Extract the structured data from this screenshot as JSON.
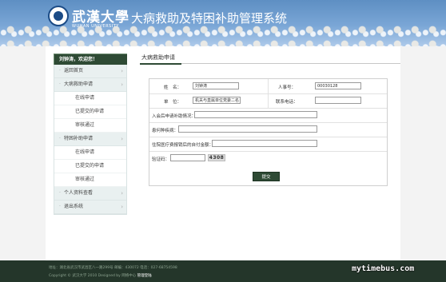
{
  "header": {
    "university_name": "武漢大學",
    "university_en": "WUHAN UNIVERSITY",
    "system_title": "大病救助及特困补助管理系统",
    "logo_icon": "university-seal-icon"
  },
  "sidebar": {
    "greeting": "刘钟涛，欢迎您！",
    "items": [
      {
        "label": "返回首页",
        "type": "top"
      },
      {
        "label": "大病救助申请",
        "type": "top"
      },
      {
        "label": "在线申请",
        "type": "sub"
      },
      {
        "label": "已提交的申请",
        "type": "sub"
      },
      {
        "label": "审核通过",
        "type": "sub"
      },
      {
        "label": "特困补助申请",
        "type": "top"
      },
      {
        "label": "在线申请",
        "type": "sub"
      },
      {
        "label": "已提交的申请",
        "type": "sub"
      },
      {
        "label": "审核通过",
        "type": "sub"
      },
      {
        "label": "个人资料查看",
        "type": "top"
      },
      {
        "label": "退出系统",
        "type": "top"
      }
    ]
  },
  "content": {
    "title": "大病救助申请",
    "form": {
      "name_label": "姓　名：",
      "name_value": "刘钟涛",
      "staff_id_label": "人事号：",
      "staff_id_value": "00030128",
      "unit_label": "单　位：",
      "unit_value": "机关与直属单位党委二名",
      "phone_label": "联系电话：",
      "phone_value": "",
      "prior_aid_label": "入会后申请补助情况：",
      "prior_aid_value": "",
      "illness_label": "患何种疾病：",
      "illness_value": "",
      "self_pay_label": "住院医疗费报销后的自付金额：",
      "self_pay_value": "",
      "captcha_label": "验证码：",
      "captcha_value": "",
      "captcha_code": "4308",
      "submit_label": "提交"
    }
  },
  "footer": {
    "line1": "地址：湖北省武汉市武昌区八一路299号   邮编：430072   电话：027-68754598",
    "line2_prefix": "Copyright © 武汉大学 2010 Designed by 网络中心",
    "line2_link": "管理登陆"
  },
  "watermark": "mytimebus.com",
  "colors": {
    "accent": "#2e4a34",
    "header_blue": "#6d9ccf",
    "footer_bg": "#24362a"
  }
}
